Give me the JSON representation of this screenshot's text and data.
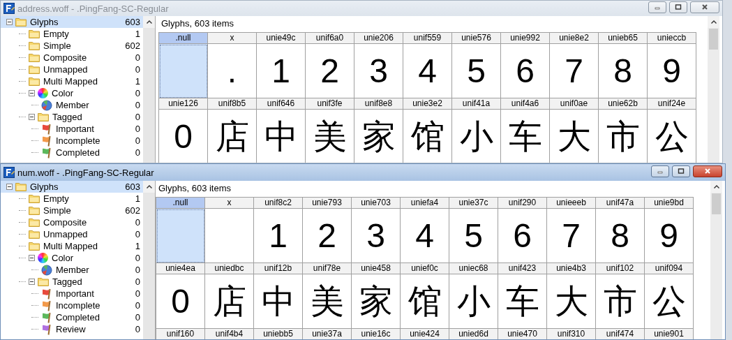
{
  "windows": [
    {
      "title": "address.woff - .PingFang-SC-Regular",
      "active": false,
      "tree": [
        {
          "label": "Glyphs",
          "count": "603",
          "kind": "folder",
          "selected": true,
          "expanded": true,
          "children": [
            {
              "label": "Empty",
              "count": "1",
              "kind": "folder",
              "selected": false
            },
            {
              "label": "Simple",
              "count": "602",
              "kind": "folder",
              "selected": false
            },
            {
              "label": "Composite",
              "count": "0",
              "kind": "folder",
              "selected": false
            },
            {
              "label": "Unmapped",
              "count": "0",
              "kind": "folder",
              "selected": false
            },
            {
              "label": "Multi Mapped",
              "count": "1",
              "kind": "folder",
              "selected": false
            },
            {
              "label": "Color",
              "count": "0",
              "kind": "wheel",
              "selected": false,
              "expanded": true,
              "children": [
                {
                  "label": "Member",
                  "count": "0",
                  "kind": "pie",
                  "selected": false
                }
              ]
            },
            {
              "label": "Tagged",
              "count": "0",
              "kind": "folder",
              "selected": false,
              "expanded": true,
              "children": [
                {
                  "label": "Important",
                  "count": "0",
                  "kind": "flag",
                  "color": "#e84a3c",
                  "selected": false
                },
                {
                  "label": "Incomplete",
                  "count": "0",
                  "kind": "flag",
                  "color": "#f39a4a",
                  "selected": false
                },
                {
                  "label": "Completed",
                  "count": "0",
                  "kind": "flag",
                  "color": "#5cb85c",
                  "selected": false
                }
              ]
            }
          ]
        }
      ],
      "list_title": "Glyphs, 603 items",
      "rows": [
        [
          {
            "name": ".null",
            "selected": true
          },
          {
            "name": "x",
            "glyph": ".",
            "selected": false
          },
          {
            "name": "unie49c",
            "glyph": "1",
            "selected": false
          },
          {
            "name": "unif6a0",
            "glyph": "2",
            "selected": false
          },
          {
            "name": "unie206",
            "glyph": "3",
            "selected": false
          },
          {
            "name": "unif559",
            "glyph": "4",
            "selected": false
          },
          {
            "name": "unie576",
            "glyph": "5",
            "selected": false
          },
          {
            "name": "unie992",
            "glyph": "6",
            "selected": false
          },
          {
            "name": "unie8e2",
            "glyph": "7",
            "selected": false
          },
          {
            "name": "unieb65",
            "glyph": "8",
            "selected": false
          },
          {
            "name": "unieccb",
            "glyph": "9",
            "selected": false
          }
        ],
        [
          {
            "name": "unie126",
            "glyph": "0",
            "selected": false
          },
          {
            "name": "unif8b5",
            "glyph": "店",
            "selected": false
          },
          {
            "name": "unif646",
            "glyph": "中",
            "selected": false
          },
          {
            "name": "unif3fe",
            "glyph": "美",
            "selected": false
          },
          {
            "name": "unif8e8",
            "glyph": "家",
            "selected": false
          },
          {
            "name": "unie3e2",
            "glyph": "馆",
            "selected": false
          },
          {
            "name": "unif41a",
            "glyph": "小",
            "selected": false
          },
          {
            "name": "unif4a6",
            "glyph": "车",
            "selected": false
          },
          {
            "name": "unif0ae",
            "glyph": "大",
            "selected": false
          },
          {
            "name": "unie62b",
            "glyph": "市",
            "selected": false
          },
          {
            "name": "unif24e",
            "glyph": "公",
            "selected": false
          }
        ]
      ]
    },
    {
      "title": "num.woff - .PingFang-SC-Regular",
      "active": true,
      "tree": [
        {
          "label": "Glyphs",
          "count": "603",
          "kind": "folder",
          "selected": true,
          "expanded": true,
          "children": [
            {
              "label": "Empty",
              "count": "1",
              "kind": "folder",
              "selected": false
            },
            {
              "label": "Simple",
              "count": "602",
              "kind": "folder",
              "selected": false
            },
            {
              "label": "Composite",
              "count": "0",
              "kind": "folder",
              "selected": false
            },
            {
              "label": "Unmapped",
              "count": "0",
              "kind": "folder",
              "selected": false
            },
            {
              "label": "Multi Mapped",
              "count": "1",
              "kind": "folder",
              "selected": false
            },
            {
              "label": "Color",
              "count": "0",
              "kind": "wheel",
              "selected": false,
              "expanded": true,
              "children": [
                {
                  "label": "Member",
                  "count": "0",
                  "kind": "pie",
                  "selected": false
                }
              ]
            },
            {
              "label": "Tagged",
              "count": "0",
              "kind": "folder",
              "selected": false,
              "expanded": true,
              "children": [
                {
                  "label": "Important",
                  "count": "0",
                  "kind": "flag",
                  "color": "#e84a3c",
                  "selected": false
                },
                {
                  "label": "Incomplete",
                  "count": "0",
                  "kind": "flag",
                  "color": "#f39a4a",
                  "selected": false
                },
                {
                  "label": "Completed",
                  "count": "0",
                  "kind": "flag",
                  "color": "#5cb85c",
                  "selected": false
                },
                {
                  "label": "Review",
                  "count": "0",
                  "kind": "flag",
                  "color": "#b070e0",
                  "selected": false
                }
              ]
            }
          ]
        }
      ],
      "list_title": "Glyphs, 603 items",
      "rows": [
        [
          {
            "name": ".null",
            "selected": true
          },
          {
            "name": "x",
            "selected": false
          },
          {
            "name": "unif8c2",
            "glyph": "1",
            "selected": false
          },
          {
            "name": "unie793",
            "glyph": "2",
            "selected": false
          },
          {
            "name": "unie703",
            "glyph": "3",
            "selected": false
          },
          {
            "name": "uniefa4",
            "glyph": "4",
            "selected": false
          },
          {
            "name": "unie37c",
            "glyph": "5",
            "selected": false
          },
          {
            "name": "unif290",
            "glyph": "6",
            "selected": false
          },
          {
            "name": "unieeeb",
            "glyph": "7",
            "selected": false
          },
          {
            "name": "unif47a",
            "glyph": "8",
            "selected": false
          },
          {
            "name": "unie9bd",
            "glyph": "9",
            "selected": false
          }
        ],
        [
          {
            "name": "unie4ea",
            "glyph": "0",
            "selected": false
          },
          {
            "name": "uniedbc",
            "glyph": "店",
            "selected": false
          },
          {
            "name": "unif12b",
            "glyph": "中",
            "selected": false
          },
          {
            "name": "unif78e",
            "glyph": "美",
            "selected": false
          },
          {
            "name": "unie458",
            "glyph": "家",
            "selected": false
          },
          {
            "name": "unief0c",
            "glyph": "馆",
            "selected": false
          },
          {
            "name": "uniec68",
            "glyph": "小",
            "selected": false
          },
          {
            "name": "unif423",
            "glyph": "车",
            "selected": false
          },
          {
            "name": "unie4b3",
            "glyph": "大",
            "selected": false
          },
          {
            "name": "unif102",
            "glyph": "市",
            "selected": false
          },
          {
            "name": "unif094",
            "glyph": "公",
            "selected": false
          }
        ],
        [
          {
            "name": "unif160",
            "selected": false
          },
          {
            "name": "unif4b4",
            "selected": false
          },
          {
            "name": "uniebb5",
            "selected": false
          },
          {
            "name": "unie37a",
            "selected": false
          },
          {
            "name": "unie16c",
            "selected": false
          },
          {
            "name": "unie424",
            "selected": false
          },
          {
            "name": "unied6d",
            "selected": false
          },
          {
            "name": "unie470",
            "selected": false
          },
          {
            "name": "unif310",
            "selected": false
          },
          {
            "name": "unif474",
            "selected": false
          },
          {
            "name": "unie901",
            "selected": false
          }
        ]
      ]
    }
  ]
}
